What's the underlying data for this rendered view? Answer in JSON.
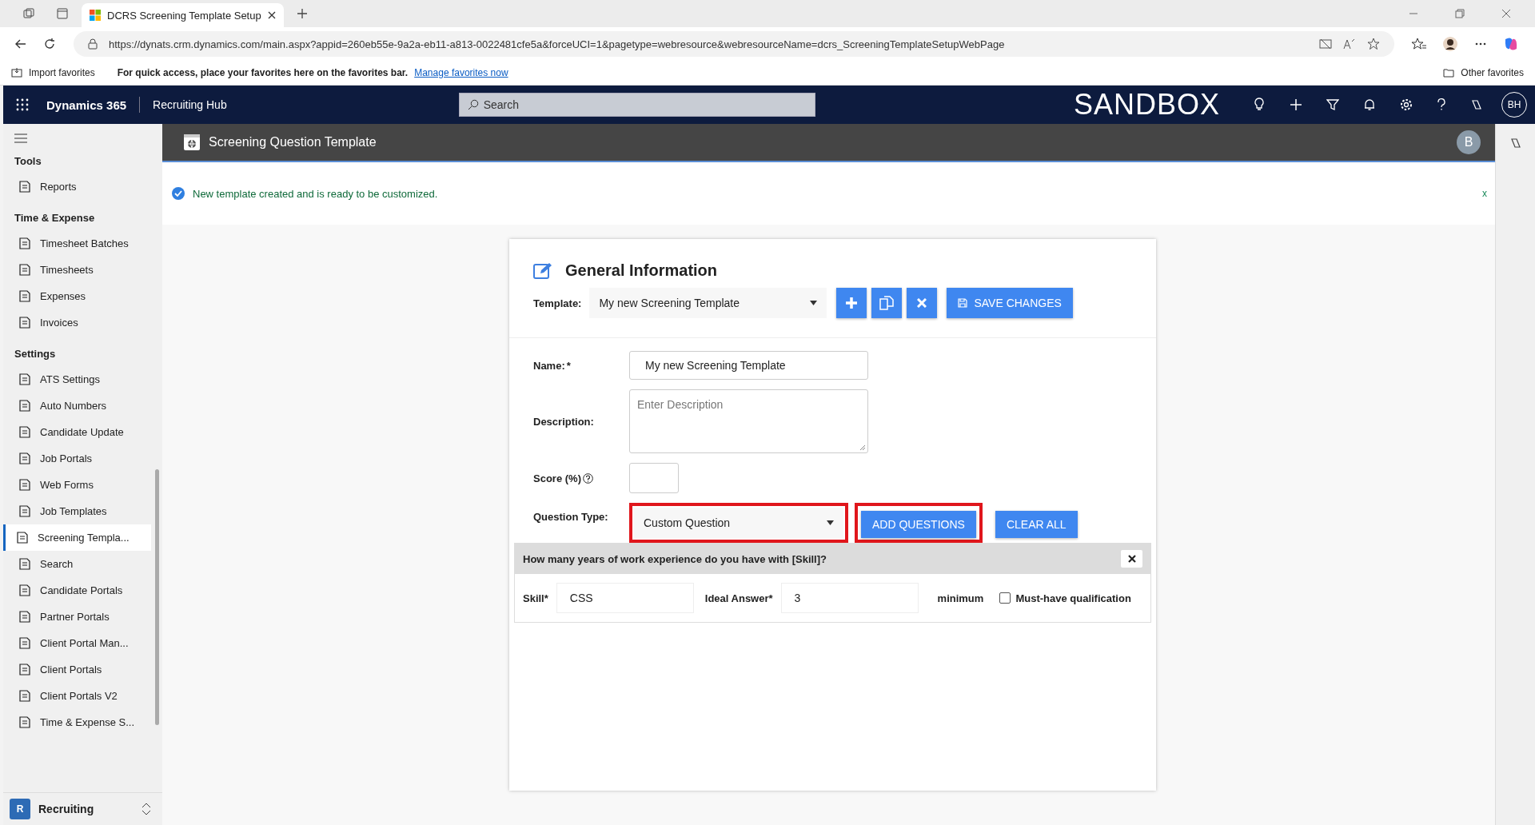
{
  "browser": {
    "tab_title": "DCRS Screening Template Setup",
    "url": "https://dynats.crm.dynamics.com/main.aspx?appid=260eb55e-9a2a-eb11-a813-0022481cfe5a&forceUCI=1&pagetype=webresource&webresourceName=dcrs_ScreeningTemplateSetupWebPage",
    "favorites": {
      "import": "Import favorites",
      "hint": "For quick access, place your favorites here on the favorites bar.",
      "link": "Manage favorites now",
      "other": "Other favorites"
    }
  },
  "app": {
    "name": "Dynamics 365",
    "area": "Recruiting Hub",
    "search_placeholder": "Search",
    "environment": "SANDBOX",
    "user_initials": "BH"
  },
  "sidebar": {
    "groups": [
      {
        "title": "Tools",
        "items": [
          {
            "label": "Reports",
            "selected": false
          }
        ]
      },
      {
        "title": "Time & Expense",
        "items": [
          {
            "label": "Timesheet Batches",
            "selected": false
          },
          {
            "label": "Timesheets",
            "selected": false
          },
          {
            "label": "Expenses",
            "selected": false
          },
          {
            "label": "Invoices",
            "selected": false
          }
        ]
      },
      {
        "title": "Settings",
        "items": [
          {
            "label": "ATS Settings",
            "selected": false
          },
          {
            "label": "Auto Numbers",
            "selected": false
          },
          {
            "label": "Candidate Update",
            "selected": false
          },
          {
            "label": "Job Portals",
            "selected": false
          },
          {
            "label": "Web Forms",
            "selected": false
          },
          {
            "label": "Job Templates",
            "selected": false
          },
          {
            "label": "Screening Templa...",
            "selected": true
          },
          {
            "label": "Search",
            "selected": false
          },
          {
            "label": "Candidate Portals",
            "selected": false
          },
          {
            "label": "Partner Portals",
            "selected": false
          },
          {
            "label": "Client Portal Man...",
            "selected": false
          },
          {
            "label": "Client Portals",
            "selected": false
          },
          {
            "label": "Client Portals V2",
            "selected": false
          },
          {
            "label": "Time & Expense S...",
            "selected": false
          }
        ]
      }
    ],
    "area": {
      "badge": "R",
      "label": "Recruiting"
    }
  },
  "page": {
    "title": "Screening Question Template",
    "user_initial": "B",
    "notice": "New template created and is ready to be customized.",
    "notice_close": "x"
  },
  "form": {
    "title": "General Information",
    "template_label": "Template:",
    "template_value": "My new Screening Template",
    "save_label": "SAVE CHANGES",
    "name": {
      "label": "Name:",
      "required_mark": "*",
      "value": "My new Screening Template"
    },
    "description": {
      "label": "Description:",
      "placeholder": "Enter Description"
    },
    "score": {
      "label": "Score (%)"
    },
    "question_type": {
      "label": "Question Type:",
      "value": "Custom Question",
      "highlighted": true
    },
    "actions": [
      {
        "label": "ADD QUESTIONS",
        "highlighted": true
      },
      {
        "label": "CLEAR ALL",
        "highlighted": false
      }
    ],
    "question": {
      "text": "How many years of work experience do you have with [Skill]?",
      "skill_label": "Skill*",
      "skill_value": "CSS",
      "ideal_label": "Ideal Answer*",
      "ideal_value": "3",
      "unit": "minimum",
      "must_have": {
        "label": "Must-have qualification",
        "checked": false
      }
    }
  }
}
